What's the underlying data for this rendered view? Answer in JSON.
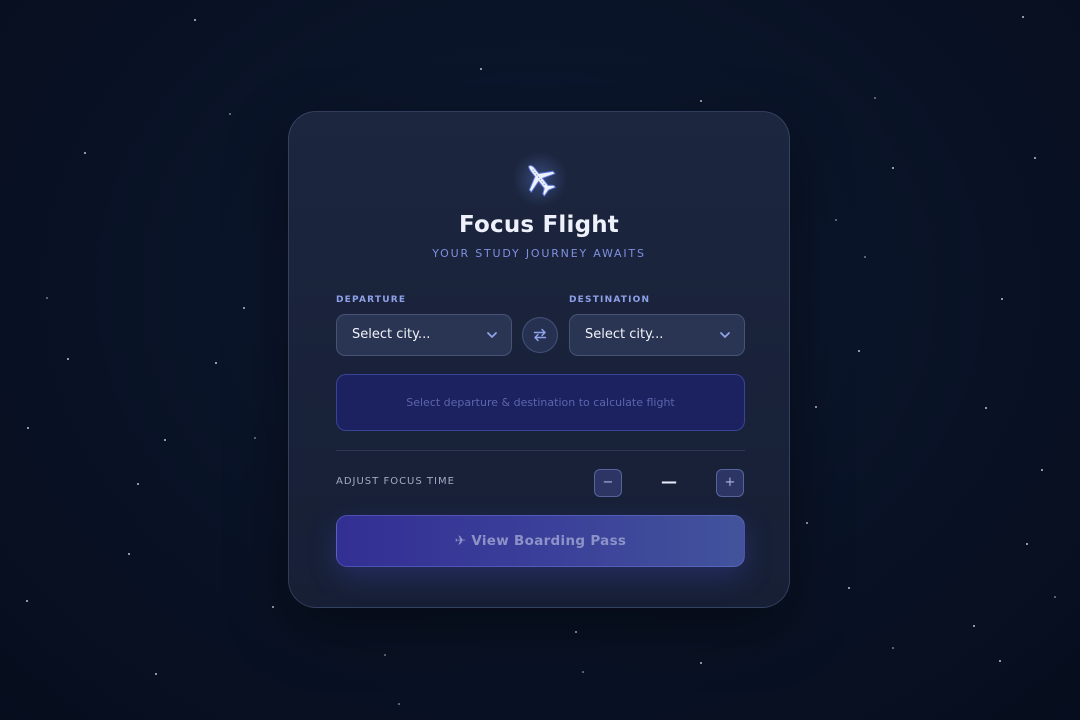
{
  "app": {
    "title": "Focus Flight",
    "subtitle": "YOUR STUDY JOURNEY AWAITS"
  },
  "route": {
    "departure_label": "DEPARTURE",
    "departure_value": "Select city...",
    "destination_label": "DESTINATION",
    "destination_value": "Select city...",
    "info_message": "Select departure & destination to calculate flight"
  },
  "focus": {
    "label": "ADJUST FOCUS TIME",
    "minus": "−",
    "plus": "+",
    "value": "—"
  },
  "cta": {
    "label": "✈ View Boarding Pass"
  },
  "icons": {
    "logo": "airplane-icon",
    "swap": "swap-arrows-icon",
    "dropdown": "chevron-down-icon"
  },
  "colors": {
    "accent": "#7f90e0",
    "card_bg": "#1e2840",
    "info_bg": "#1c2160",
    "cta_start": "#332f94",
    "cta_end": "#42539b"
  }
}
